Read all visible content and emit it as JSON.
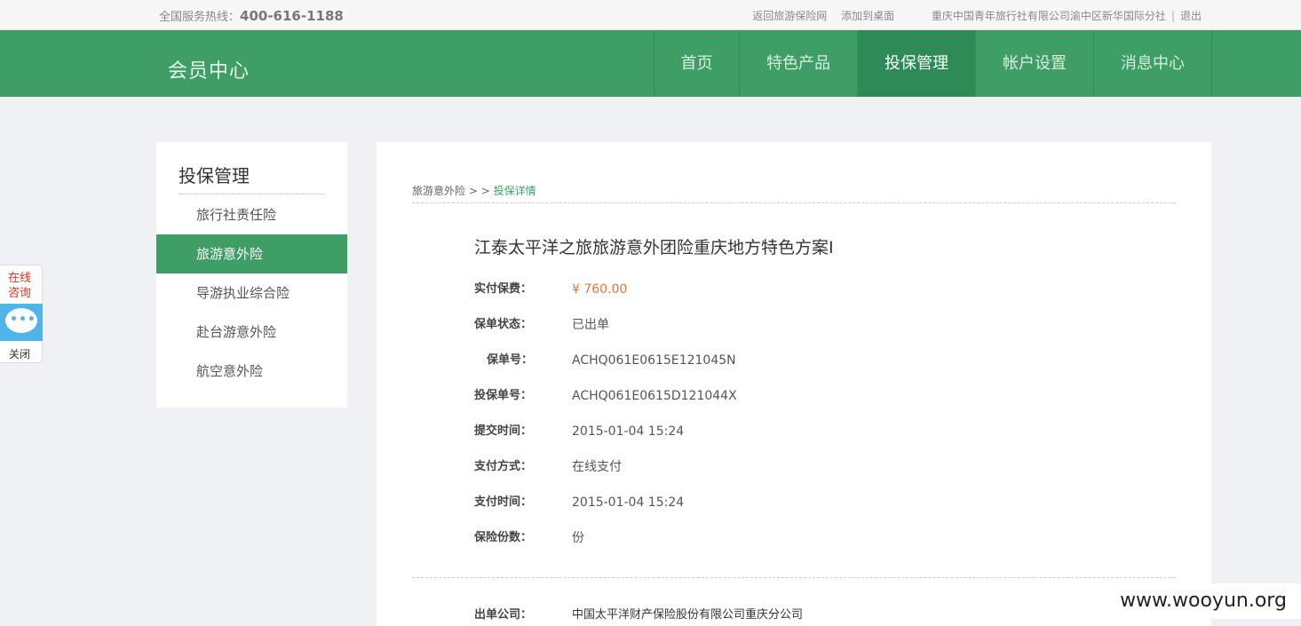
{
  "topbar": {
    "hotline_label": "全国服务热线：",
    "hotline_number": "400-616-1188",
    "link_back": "返回旅游保险网",
    "link_desktop": "添加到桌面",
    "agency": "重庆中国青年旅行社有限公司渝中区新华国际分社",
    "separator": "|",
    "logout": "退出"
  },
  "nav": {
    "brand": "会员中心",
    "items": [
      {
        "label": "首页"
      },
      {
        "label": "特色产品"
      },
      {
        "label": "投保管理"
      },
      {
        "label": "帐户设置"
      },
      {
        "label": "消息中心"
      }
    ],
    "active": "投保管理"
  },
  "sidebar": {
    "title": "投保管理",
    "items": [
      {
        "label": "旅行社责任险"
      },
      {
        "label": "旅游意外险"
      },
      {
        "label": "导游执业综合险"
      },
      {
        "label": "赴台游意外险"
      },
      {
        "label": "航空意外险"
      }
    ]
  },
  "breadcrumb": {
    "parent": "旅游意外险",
    "sep": " > > ",
    "current": "投保详情"
  },
  "detail": {
    "title": "江泰太平洋之旅旅游意外团险重庆地方特色方案I",
    "rows": [
      {
        "key": "实付保费：",
        "value": "¥ 760.00"
      },
      {
        "key": "保单状态：",
        "value": "已出单"
      },
      {
        "key": "保单号：",
        "value": "ACHQ061E0615E121045N"
      },
      {
        "key": "投保单号：",
        "value": "ACHQ061E0615D121044X"
      },
      {
        "key": "提交时间：",
        "value": "2015-01-04 15:24"
      },
      {
        "key": "支付方式：",
        "value": "在线支付"
      },
      {
        "key": "支付时间：",
        "value": "2015-01-04 15:24"
      },
      {
        "key": "保险份数：",
        "value": "份"
      }
    ],
    "company_key": "出单公司：",
    "company_value": "中国太平洋财产保险股份有限公司重庆分公司"
  },
  "chat": {
    "label": "在线咨询",
    "close": "关闭",
    "icon": "chat-bubble-icon",
    "accent": "#4fb4e8"
  },
  "watermark": "www.wooyun.org",
  "colors": {
    "primary": "#3f9e66",
    "price": "#e8743b"
  }
}
